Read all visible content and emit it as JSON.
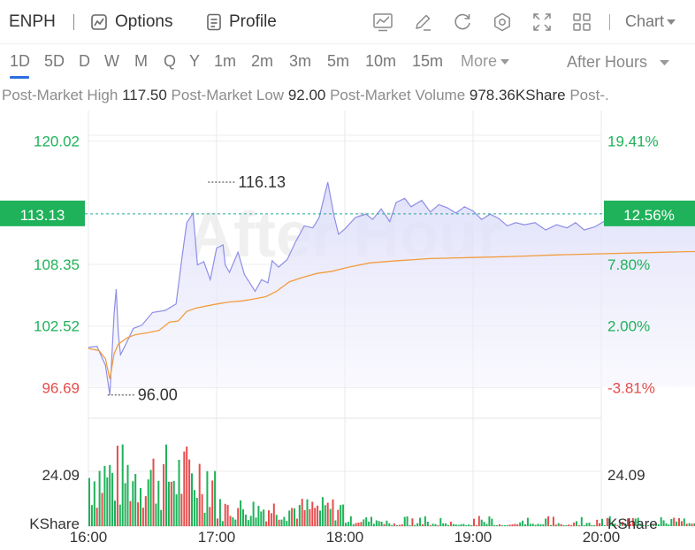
{
  "header": {
    "ticker": "ENPH",
    "options_label": "Options",
    "profile_label": "Profile",
    "chart_label": "Chart"
  },
  "periods": [
    "1D",
    "5D",
    "D",
    "W",
    "M",
    "Q",
    "Y",
    "1m",
    "2m",
    "3m",
    "5m",
    "10m",
    "15m"
  ],
  "active_period": "1D",
  "more_label": "More",
  "session_label": "After Hours",
  "stats": {
    "high_label": "Post-Market High",
    "high_value": "117.50",
    "low_label": "Post-Market Low",
    "low_value": "92.00",
    "volume_label": "Post-Market Volume",
    "volume_value": "978.36KShare",
    "trailing_label": "Post-."
  },
  "watermark": "After Hour",
  "colors": {
    "up": "#1fb25a",
    "down": "#e74c4c",
    "price_line": "#8e8ee6",
    "avg_line": "#f39c3d",
    "accent": "#2b6de0"
  },
  "chart_data": {
    "type": "line",
    "x": [
      "16:00",
      "17:00",
      "18:00",
      "19:00",
      "20:00"
    ],
    "y_ticks_left": [
      {
        "value": 120.02,
        "label": "120.02",
        "color": "up"
      },
      {
        "value": 108.35,
        "label": "108.35",
        "color": "up"
      },
      {
        "value": 102.52,
        "label": "102.52",
        "color": "up"
      },
      {
        "value": 96.69,
        "label": "96.69",
        "color": "down"
      }
    ],
    "y_ticks_right": [
      {
        "value": 120.02,
        "label": "19.41%",
        "color": "up"
      },
      {
        "value": 108.35,
        "label": "7.80%",
        "color": "up"
      },
      {
        "value": 102.52,
        "label": "2.00%",
        "color": "up"
      },
      {
        "value": 96.69,
        "label": "-3.81%",
        "color": "down"
      }
    ],
    "ylim": [
      93.8,
      122.9
    ],
    "current": {
      "value": 113.13,
      "label": "113.13",
      "pct": "12.56%"
    },
    "annotations": [
      {
        "time_min": 56,
        "value": 116.13,
        "label": "116.13"
      },
      {
        "time_min": 9,
        "value": 96.0,
        "label": "96.00"
      }
    ],
    "series": [
      {
        "name": "Price",
        "points": [
          [
            0,
            100.5
          ],
          [
            4,
            100.6
          ],
          [
            8,
            98.8
          ],
          [
            10,
            96.0
          ],
          [
            12,
            103.6
          ],
          [
            13,
            106.0
          ],
          [
            14,
            101.8
          ],
          [
            15,
            99.8
          ],
          [
            17,
            100.6
          ],
          [
            21,
            102.3
          ],
          [
            25,
            102.6
          ],
          [
            30,
            103.8
          ],
          [
            36,
            104.0
          ],
          [
            41,
            104.6
          ],
          [
            44,
            109.3
          ],
          [
            46,
            112.3
          ],
          [
            49,
            113.2
          ],
          [
            51,
            108.3
          ],
          [
            54,
            108.6
          ],
          [
            57,
            106.9
          ],
          [
            60,
            109.9
          ],
          [
            63,
            110.2
          ],
          [
            64,
            108.3
          ],
          [
            66,
            107.6
          ],
          [
            70,
            109.5
          ],
          [
            73,
            107.4
          ],
          [
            78,
            105.8
          ],
          [
            81,
            106.9
          ],
          [
            84,
            106.6
          ],
          [
            86,
            108.7
          ],
          [
            89,
            108.1
          ],
          [
            93,
            108.8
          ],
          [
            97,
            110.5
          ],
          [
            101,
            112.0
          ],
          [
            105,
            111.8
          ],
          [
            108,
            112.8
          ],
          [
            112,
            116.13
          ],
          [
            115,
            112.9
          ],
          [
            117,
            111.2
          ],
          [
            120,
            111.7
          ],
          [
            125,
            112.8
          ],
          [
            130,
            113.1
          ],
          [
            133,
            112.6
          ],
          [
            137,
            113.6
          ],
          [
            141,
            112.4
          ],
          [
            144,
            114.2
          ],
          [
            148,
            114.6
          ],
          [
            151,
            113.8
          ],
          [
            156,
            114.4
          ],
          [
            160,
            113.3
          ],
          [
            164,
            114.0
          ],
          [
            168,
            113.7
          ],
          [
            172,
            113.2
          ],
          [
            176,
            113.8
          ],
          [
            180,
            113.4
          ],
          [
            184,
            112.6
          ],
          [
            188,
            113.1
          ],
          [
            192,
            112.7
          ],
          [
            196,
            112.0
          ],
          [
            200,
            112.3
          ],
          [
            204,
            112.1
          ],
          [
            209,
            112.3
          ],
          [
            214,
            111.6
          ],
          [
            219,
            112.1
          ],
          [
            224,
            111.8
          ],
          [
            228,
            112.3
          ],
          [
            232,
            111.6
          ],
          [
            237,
            111.9
          ],
          [
            242,
            112.5
          ],
          [
            247,
            112.9
          ],
          [
            252,
            113.2
          ],
          [
            257,
            112.9
          ],
          [
            262,
            113.2
          ],
          [
            268,
            113.5
          ],
          [
            274,
            113.1
          ],
          [
            280,
            113.4
          ],
          [
            286,
            113.1
          ],
          [
            292,
            113.3
          ],
          [
            298,
            113.1
          ],
          [
            304,
            113.4
          ],
          [
            310,
            113.0
          ],
          [
            316,
            113.2
          ],
          [
            322,
            113.4
          ],
          [
            328,
            113.13
          ]
        ]
      },
      {
        "name": "Average",
        "points": [
          [
            0,
            100.4
          ],
          [
            5,
            100.2
          ],
          [
            8,
            99.4
          ],
          [
            10,
            97.5
          ],
          [
            12,
            99.9
          ],
          [
            14,
            100.8
          ],
          [
            18,
            101.4
          ],
          [
            22,
            101.7
          ],
          [
            28,
            101.9
          ],
          [
            33,
            102.1
          ],
          [
            38,
            102.9
          ],
          [
            42,
            103.0
          ],
          [
            46,
            103.9
          ],
          [
            50,
            104.2
          ],
          [
            55,
            104.4
          ],
          [
            60,
            104.6
          ],
          [
            66,
            104.8
          ],
          [
            72,
            104.9
          ],
          [
            78,
            105.1
          ],
          [
            83,
            105.3
          ],
          [
            88,
            105.8
          ],
          [
            94,
            106.7
          ],
          [
            100,
            107.1
          ],
          [
            107,
            107.5
          ],
          [
            114,
            107.7
          ],
          [
            122,
            108.1
          ],
          [
            132,
            108.5
          ],
          [
            145,
            108.7
          ],
          [
            160,
            108.9
          ],
          [
            180,
            109.0
          ],
          [
            200,
            109.1
          ],
          [
            220,
            109.25
          ],
          [
            240,
            109.35
          ],
          [
            260,
            109.45
          ],
          [
            280,
            109.55
          ],
          [
            300,
            109.6
          ],
          [
            328,
            109.65
          ]
        ]
      }
    ],
    "volume": {
      "unit": "KShare",
      "tick_label": "24.09",
      "tick_value": 24.09,
      "max": 50
    }
  }
}
